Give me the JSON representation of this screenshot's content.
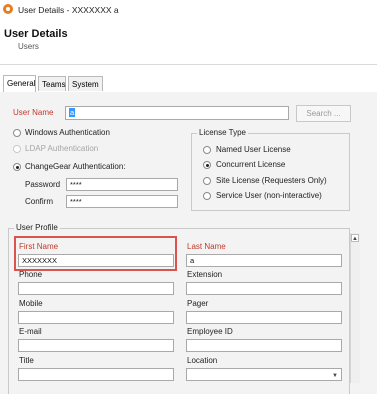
{
  "window": {
    "title": "User Details - XXXXXXX a"
  },
  "header": {
    "title": "User Details",
    "subtitle": "Users"
  },
  "tabs": [
    {
      "label": "General",
      "active": true
    },
    {
      "label": "Teams",
      "active": false
    },
    {
      "label": "System",
      "active": false
    }
  ],
  "general": {
    "user_name_label": "User Name",
    "user_name_value": "a",
    "search_button": "Search ...",
    "auth_options": [
      {
        "label": "Windows Authentication",
        "checked": false,
        "disabled": false
      },
      {
        "label": "LDAP Authentication",
        "checked": false,
        "disabled": true
      },
      {
        "label": "ChangeGear Authentication:",
        "checked": true,
        "disabled": false
      }
    ],
    "password_label": "Password",
    "password_value": "****",
    "confirm_label": "Confirm",
    "confirm_value": "****",
    "license_type": {
      "legend": "License Type",
      "options": [
        {
          "label": "Named User License",
          "checked": false
        },
        {
          "label": "Concurrent License",
          "checked": true
        },
        {
          "label": "Site License (Requesters Only)",
          "checked": false
        },
        {
          "label": "Service User (non-interactive)",
          "checked": false
        }
      ]
    }
  },
  "profile": {
    "legend": "User Profile",
    "first_name_label": "First Name",
    "first_name_value": "XXXXXXX",
    "last_name_label": "Last Name",
    "last_name_value": "a",
    "phone_label": "Phone",
    "extension_label": "Extension",
    "mobile_label": "Mobile",
    "pager_label": "Pager",
    "email_label": "E-mail",
    "employee_id_label": "Employee ID",
    "title_label": "Title",
    "location_label": "Location"
  },
  "colors": {
    "required_label": "#c0392b",
    "highlight_border": "#d9534f",
    "selection": "#3399ff",
    "app_icon": "#e67e22"
  }
}
